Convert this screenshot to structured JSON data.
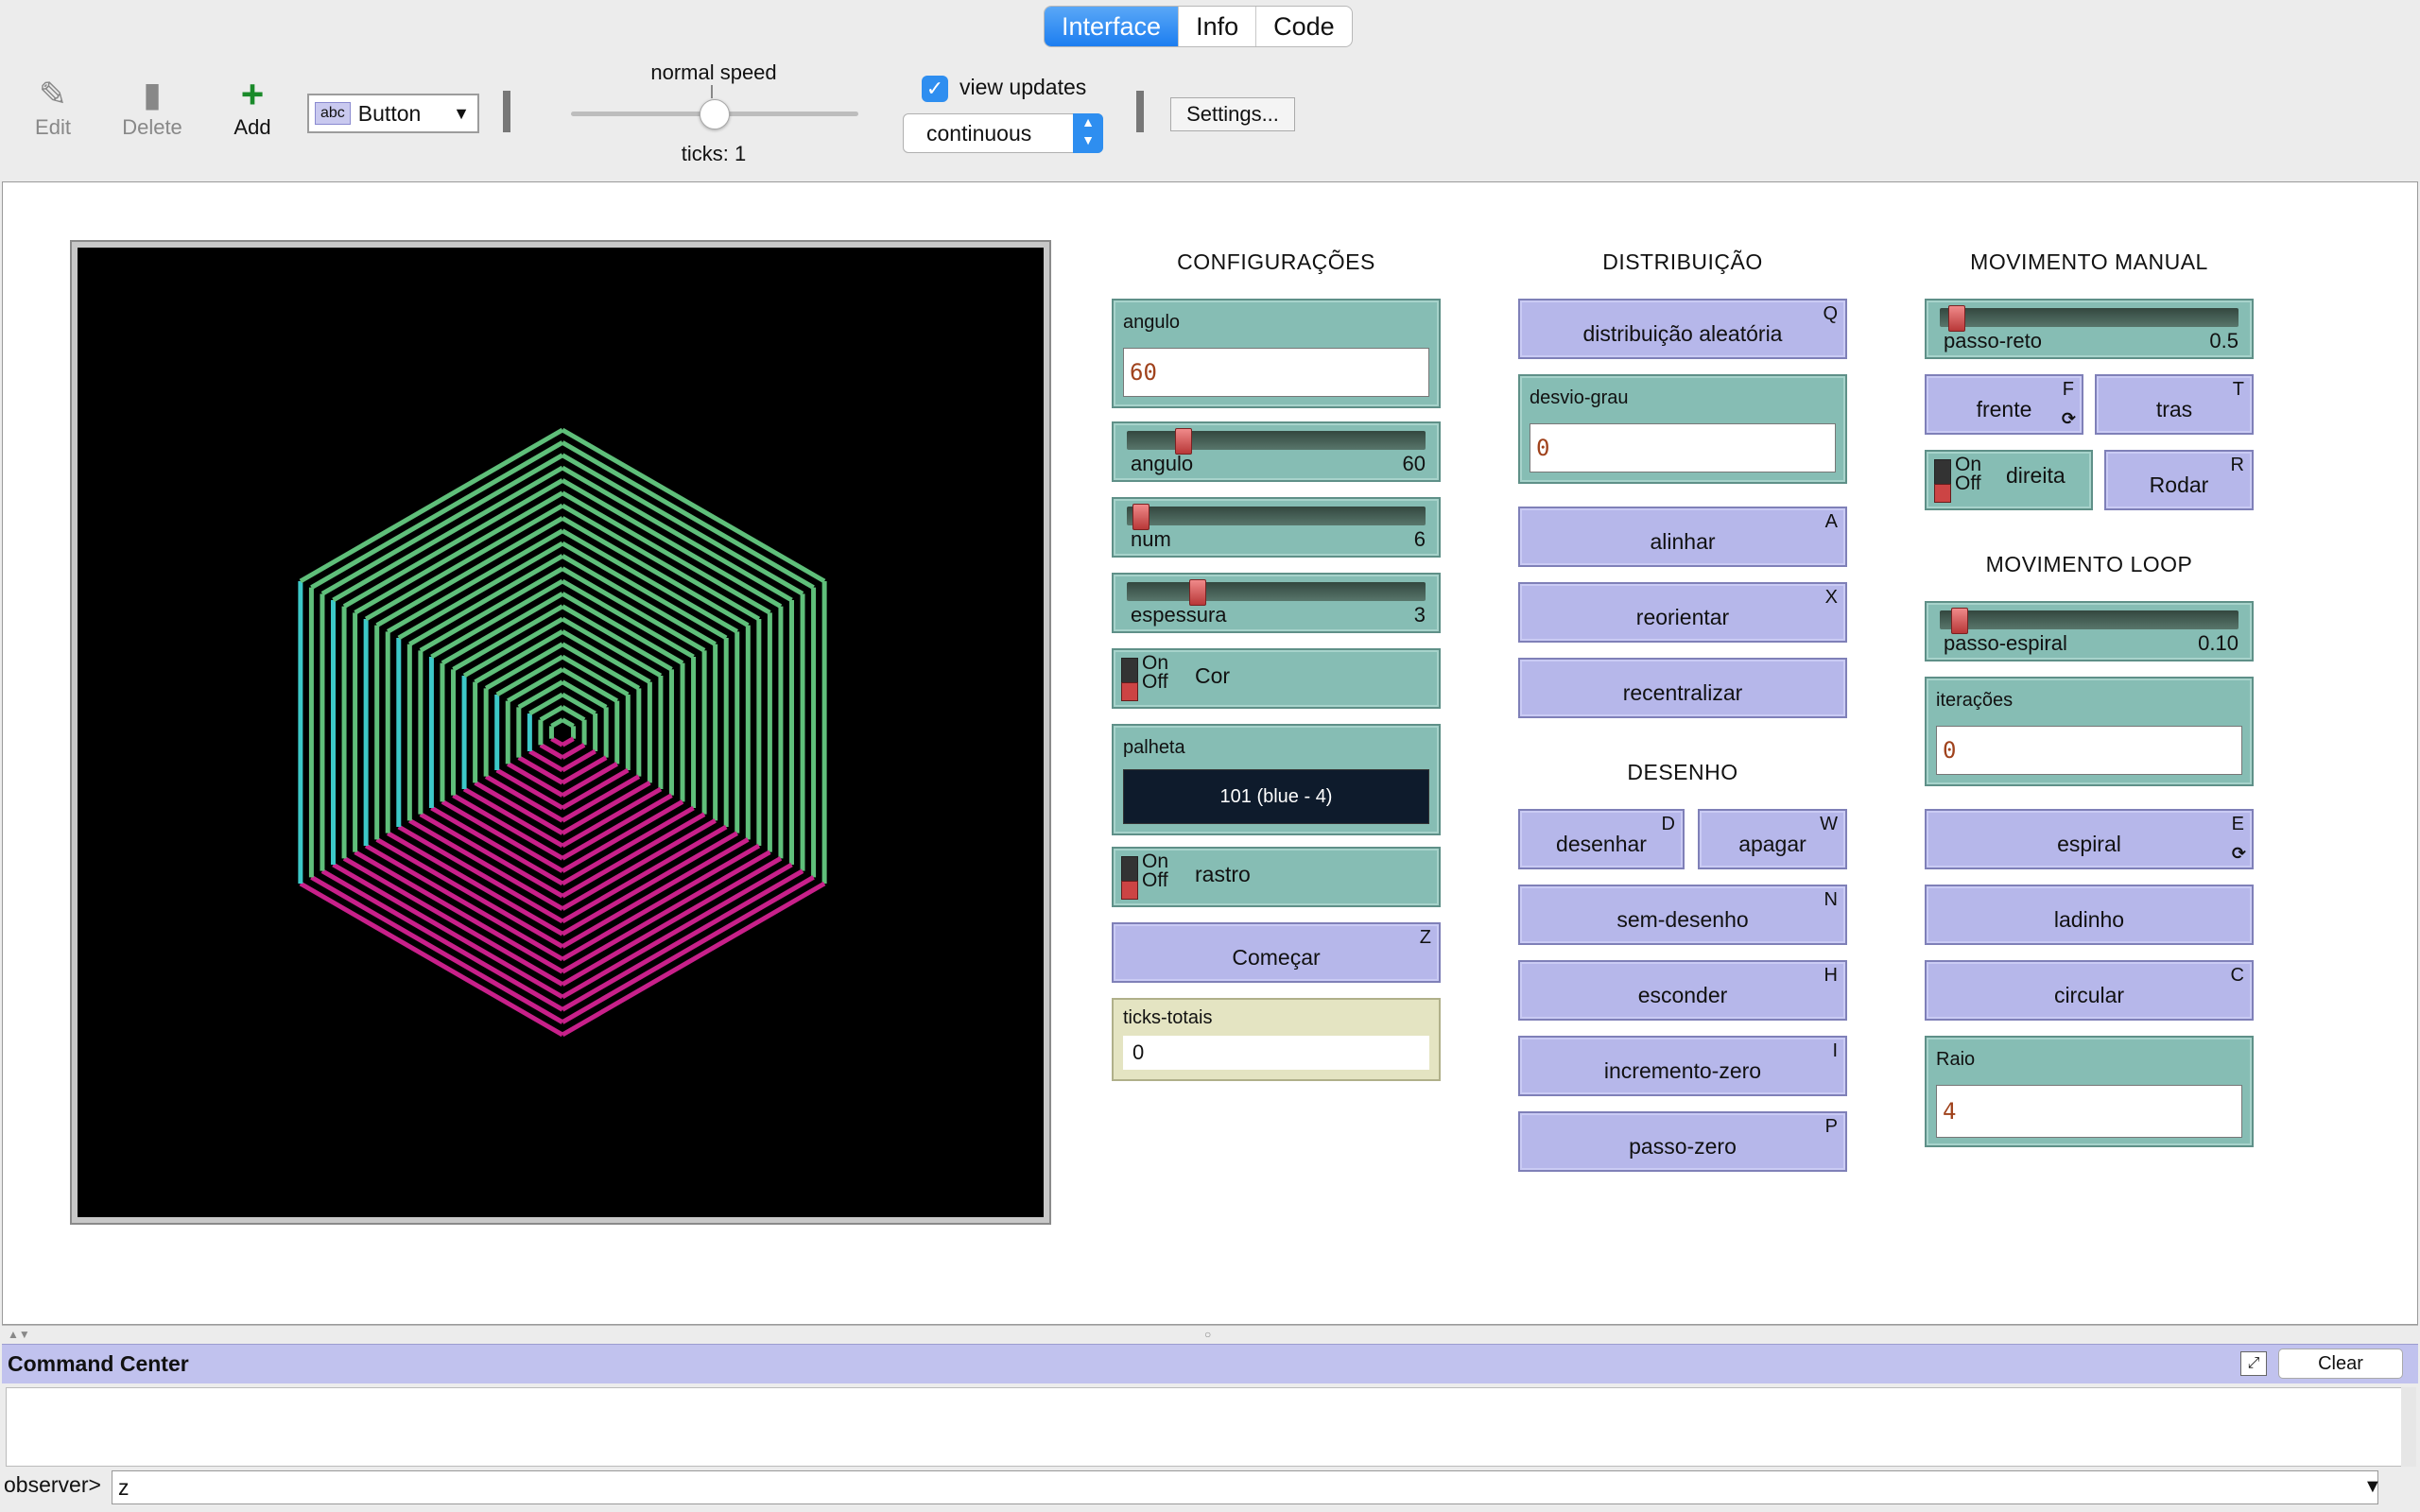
{
  "tabs": [
    {
      "label": "Interface",
      "active": true
    },
    {
      "label": "Info",
      "active": false
    },
    {
      "label": "Code",
      "active": false
    }
  ],
  "toolbar": {
    "edit_label": "Edit",
    "delete_label": "Delete",
    "add_label": "Add",
    "widget_type_icon_text": "abc",
    "widget_type": "Button",
    "speed_label": "normal speed",
    "speed_value": 0.5,
    "ticks_label": "ticks: 1",
    "view_updates_label": "view updates",
    "view_updates_checked": true,
    "update_mode": "continuous",
    "settings_label": "Settings..."
  },
  "sections": {
    "config": "CONFIGURAÇÕES",
    "distribution": "DISTRIBUIÇÃO",
    "drawing": "DESENHO",
    "manual": "MOVIMENTO MANUAL",
    "loop": "MOVIMENTO LOOP"
  },
  "config": {
    "angulo_input": {
      "label": "angulo",
      "value": "60"
    },
    "angulo_slider": {
      "label": "angulo",
      "value": "60",
      "fraction": 0.17
    },
    "num_slider": {
      "label": "num",
      "value": "6",
      "fraction": 0.02
    },
    "espessura_slider": {
      "label": "espessura",
      "value": "3",
      "fraction": 0.22
    },
    "cor_switch": {
      "on": "On",
      "off": "Off",
      "label": "Cor"
    },
    "palheta": {
      "label": "palheta",
      "value": "101 (blue - 4)"
    },
    "rastro_switch": {
      "on": "On",
      "off": "Off",
      "label": "rastro"
    },
    "comecar": {
      "label": "Começar",
      "key": "Z"
    },
    "ticks_totais": {
      "label": "ticks-totais",
      "value": "0"
    }
  },
  "distribution": {
    "aleatoria": {
      "label": "distribuição aleatória",
      "key": "Q"
    },
    "desvio_grau": {
      "label": "desvio-grau",
      "value": "0"
    },
    "alinhar": {
      "label": "alinhar",
      "key": "A"
    },
    "reorientar": {
      "label": "reorientar",
      "key": "X"
    },
    "recentralizar": {
      "label": "recentralizar",
      "key": ""
    }
  },
  "drawing": {
    "desenhar": {
      "label": "desenhar",
      "key": "D"
    },
    "apagar": {
      "label": "apagar",
      "key": "W"
    },
    "sem_desenho": {
      "label": "sem-desenho",
      "key": "N"
    },
    "esconder": {
      "label": "esconder",
      "key": "H"
    },
    "incremento_zero": {
      "label": "incremento-zero",
      "key": "I"
    },
    "passo_zero": {
      "label": "passo-zero",
      "key": "P"
    }
  },
  "manual": {
    "passo_reto": {
      "label": "passo-reto",
      "value": "0.5",
      "fraction": 0.03
    },
    "frente": {
      "label": "frente",
      "key": "F"
    },
    "tras": {
      "label": "tras",
      "key": "T"
    },
    "direita_switch": {
      "on": "On",
      "off": "Off",
      "label": "direita"
    },
    "rodar": {
      "label": "Rodar",
      "key": "R"
    }
  },
  "loop": {
    "passo_espiral": {
      "label": "passo-espiral",
      "value": "0.10",
      "fraction": 0.04
    },
    "iteracoes": {
      "label": "iterações",
      "value": "0"
    },
    "espiral": {
      "label": "espiral",
      "key": "E"
    },
    "ladinho": {
      "label": "ladinho",
      "key": ""
    },
    "circular": {
      "label": "circular",
      "key": "C"
    },
    "raio": {
      "label": "Raio",
      "value": "4"
    }
  },
  "command_center": {
    "title": "Command Center",
    "clear_label": "Clear",
    "prompt": "observer>",
    "input_value": "z"
  },
  "colors": {
    "accent": "#2e8ef0",
    "widget_teal": "#86bdb4",
    "button_lavender": "#b6b7ea",
    "view_background": "#000000",
    "pattern_green": "#5fbf7a",
    "pattern_magenta": "#c8208a",
    "pattern_cyan": "#3cc8c8"
  }
}
